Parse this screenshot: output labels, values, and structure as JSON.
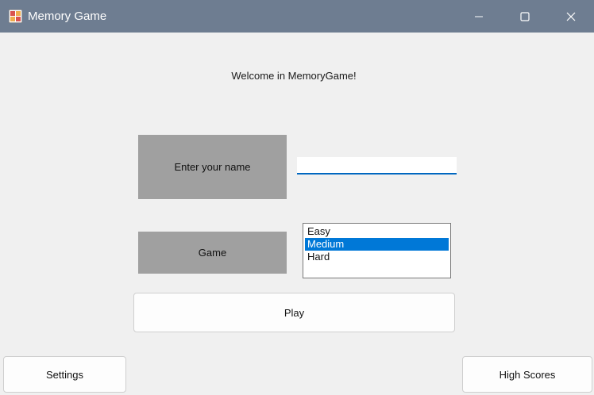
{
  "window": {
    "title": "Memory Game",
    "icon": "memory-game-app-icon",
    "controls": {
      "minimize_icon": "minimize-icon",
      "maximize_icon": "maximize-icon",
      "close_icon": "close-icon"
    },
    "titlebar_color": "#6e7d91"
  },
  "main": {
    "welcome": "Welcome in MemoryGame!",
    "name_label": "Enter your name",
    "name_input": {
      "value": "",
      "placeholder": ""
    },
    "game_label": "Game",
    "difficulty": {
      "options": [
        "Easy",
        "Medium",
        "Hard"
      ],
      "selected": "Medium"
    },
    "play_label": "Play"
  },
  "footer": {
    "settings_label": "Settings",
    "high_scores_label": "High Scores"
  },
  "colors": {
    "accent": "#0078d7",
    "label_bg": "#a0a0a0",
    "background": "#f0f0f0"
  }
}
